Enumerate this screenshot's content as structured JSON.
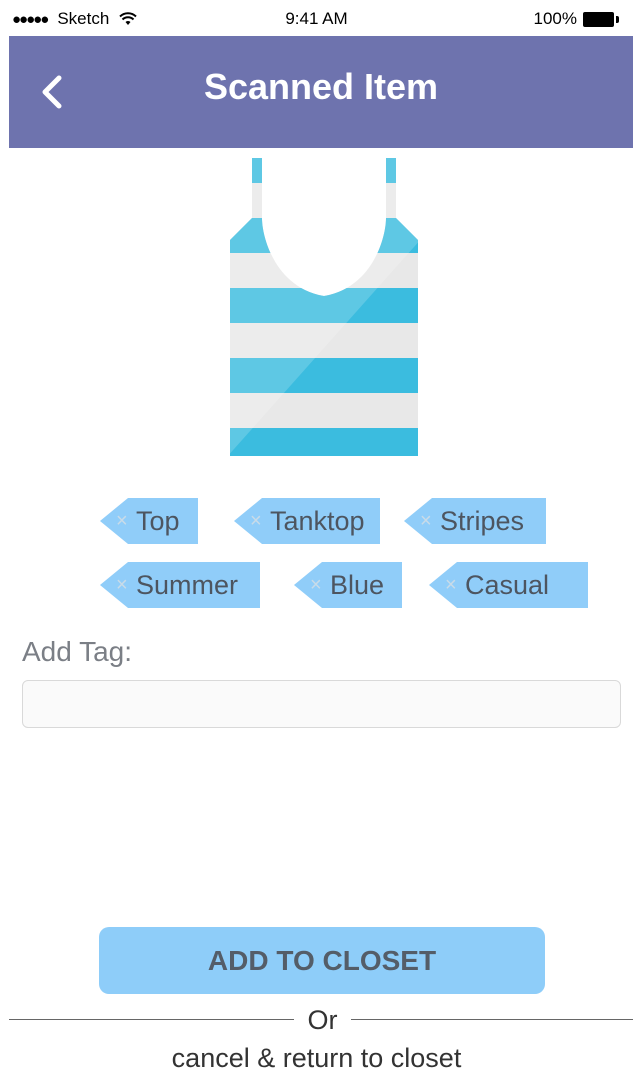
{
  "status_bar": {
    "carrier": "Sketch",
    "time": "9:41 AM",
    "battery": "100%"
  },
  "nav": {
    "title": "Scanned Item",
    "back_icon": "chevron-left-icon"
  },
  "item": {
    "image": "striped-tanktop",
    "colors": {
      "stripe": "#3bbcdf",
      "stripe_light": "#5cc8e6",
      "white": "#e8e8e8"
    }
  },
  "tags": [
    {
      "label": "Top"
    },
    {
      "label": "Tanktop"
    },
    {
      "label": "Stripes"
    },
    {
      "label": "Summer"
    },
    {
      "label": "Blue"
    },
    {
      "label": "Casual"
    }
  ],
  "tag_remove_icon": "x-icon",
  "add_tag": {
    "label": "Add Tag:",
    "value": "",
    "placeholder": ""
  },
  "actions": {
    "add_label": "ADD TO CLOSET",
    "or_label": "Or",
    "cancel_label": "cancel & return to closet"
  },
  "colors": {
    "nav_bg": "#6e73ae",
    "tag_bg": "#90cdf9",
    "button_bg": "#8ecdf9"
  }
}
